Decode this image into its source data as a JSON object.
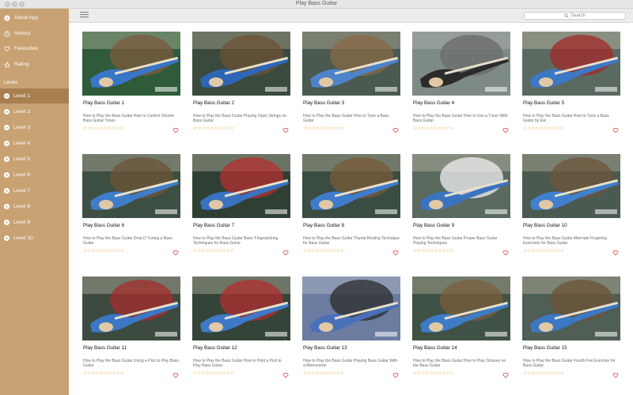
{
  "window": {
    "title": "Play Bass Guitar"
  },
  "sidebar": {
    "menu": [
      {
        "label": "About App",
        "icon": "info-icon"
      },
      {
        "label": "History",
        "icon": "clock-icon"
      },
      {
        "label": "Favourites",
        "icon": "heart-outline-icon"
      },
      {
        "label": "Rating",
        "icon": "star-outline-icon"
      }
    ],
    "levels_header": "Levels",
    "levels": [
      {
        "label": "Level 1",
        "active": true
      },
      {
        "label": "Level 2"
      },
      {
        "label": "Level 3"
      },
      {
        "label": "Level 4"
      },
      {
        "label": "Level 5"
      },
      {
        "label": "Level 6"
      },
      {
        "label": "Level 7"
      },
      {
        "label": "Level 8"
      },
      {
        "label": "Level 9"
      },
      {
        "label": "Level 10"
      }
    ]
  },
  "toolbar": {
    "menu_icon": "list-icon",
    "search_placeholder": "Search"
  },
  "colors": {
    "sidebar": "#c8a272",
    "sidebar_active": "#a8804f",
    "star": "#e3a33b",
    "heart": "#d9534f"
  },
  "videos": [
    {
      "title": "Play Bass Guitar 1",
      "description": "How to Play the Bass Guitar  How to Control Volume  Bass Guitar Tones",
      "rating": 0
    },
    {
      "title": "Play Bass Guitar 2",
      "description": "How to Play the Bass Guitar  Playing Open Strings on Bass Guitar",
      "rating": 0
    },
    {
      "title": "Play Bass Guitar 3",
      "description": "How to Play the Bass Guitar  How to Tune a Bass Guitar",
      "rating": 0
    },
    {
      "title": "Play Bass Guitar 4",
      "description": "How to Play the Bass Guitar  How to Use a Tuner With Bass Guitar",
      "rating": 0
    },
    {
      "title": "Play Bass Guitar 5",
      "description": "How to Play the Bass Guitar  How to Tune a Bass Guitar by Ear",
      "rating": 0
    },
    {
      "title": "Play Bass Guitar 6",
      "description": "How to Play the Bass Guitar  Drop D Tuning a Bass Guitar",
      "rating": 0
    },
    {
      "title": "Play Bass Guitar 7",
      "description": "How to Play the Bass Guitar  Basic Fingerpicking Techniques for Bass Guitar",
      "rating": 0
    },
    {
      "title": "Play Bass Guitar 8",
      "description": "How to Play the Bass Guitar  Thumb Resting Technique for Bass Guitar",
      "rating": 0
    },
    {
      "title": "Play Bass Guitar 9",
      "description": "How to Play the Bass Guitar  Proper Bass Guitar Playing Techniques",
      "rating": 0
    },
    {
      "title": "Play Bass Guitar 10",
      "description": "How to Play the Bass Guitar  Alternate Fingering Exercises for Bass Guitar",
      "rating": 0
    },
    {
      "title": "Play Bass Guitar 11",
      "description": "How to Play the Bass Guitar  Using a Pick to Play Bass Guitar",
      "rating": 0
    },
    {
      "title": "Play Bass Guitar 12",
      "description": "How to Play the Bass Guitar  How to Hold a Pick to Play Bass Guitar",
      "rating": 0
    },
    {
      "title": "Play Bass Guitar 13",
      "description": "How to Play the Bass Guitar  Playing Bass Guitar With a Metronome",
      "rating": 0
    },
    {
      "title": "Play Bass Guitar 14",
      "description": "How to Play the Bass Guitar  How to Play Octaves on the Bass Guitar",
      "rating": 0
    },
    {
      "title": "Play Bass Guitar 15",
      "description": "How to Play the Bass Guitar  Fourth Fret Exercise for Bass Guitar",
      "rating": 0
    }
  ]
}
